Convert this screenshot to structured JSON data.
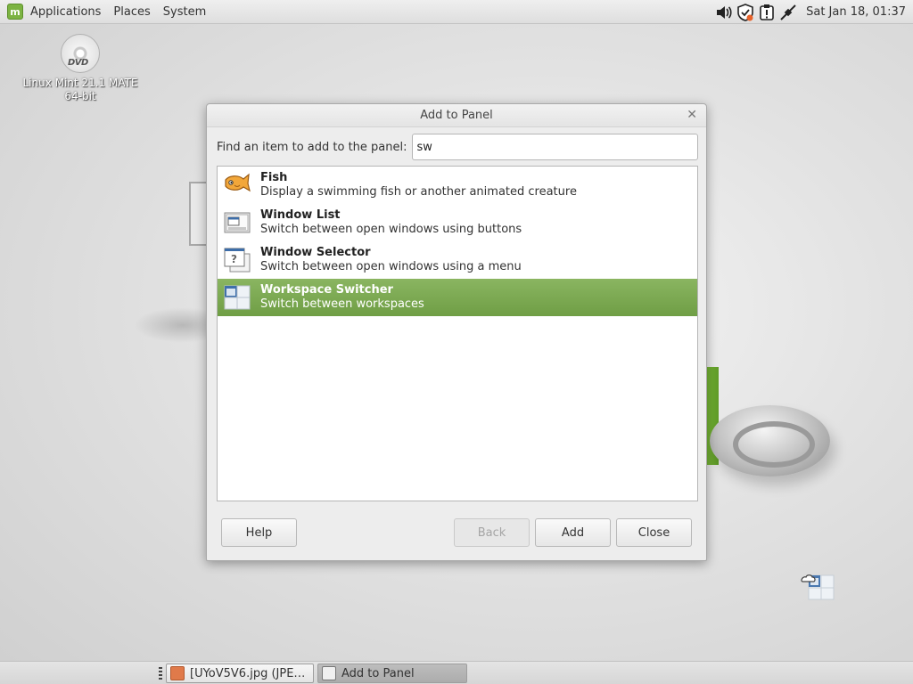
{
  "top_panel": {
    "menus": [
      "Applications",
      "Places",
      "System"
    ],
    "tray_icons": [
      "volume-icon",
      "shield-update-icon",
      "notification-icon",
      "network-icon"
    ],
    "clock": "Sat Jan 18, 01:37"
  },
  "desktop": {
    "icon_label_line1": "Linux Mint 21.1 MATE",
    "icon_label_line2": "64-bit",
    "dvd_text": "DVD"
  },
  "dialog": {
    "title": "Add to Panel",
    "find_label": "Find an item to add to the panel:",
    "search_value": "sw",
    "items": [
      {
        "title": "Fish",
        "desc": "Display a swimming fish or another animated creature",
        "icon": "fish-icon"
      },
      {
        "title": "Window List",
        "desc": "Switch between open windows using buttons",
        "icon": "window-list-icon"
      },
      {
        "title": "Window Selector",
        "desc": "Switch between open windows using a menu",
        "icon": "window-selector-icon"
      },
      {
        "title": "Workspace Switcher",
        "desc": "Switch between workspaces",
        "icon": "workspace-switcher-icon",
        "selected": true
      }
    ],
    "buttons": {
      "help": "Help",
      "back": "Back",
      "add": "Add",
      "close": "Close"
    }
  },
  "taskbar": {
    "tasks": [
      {
        "label": "[UYoV5V6.jpg (JPE…",
        "icon": "image-viewer-icon"
      },
      {
        "label": "Add to Panel",
        "icon": "dialog-window-icon",
        "active": true
      }
    ]
  },
  "colors": {
    "selection": "#7aa84f",
    "mint_green": "#7cb342"
  }
}
